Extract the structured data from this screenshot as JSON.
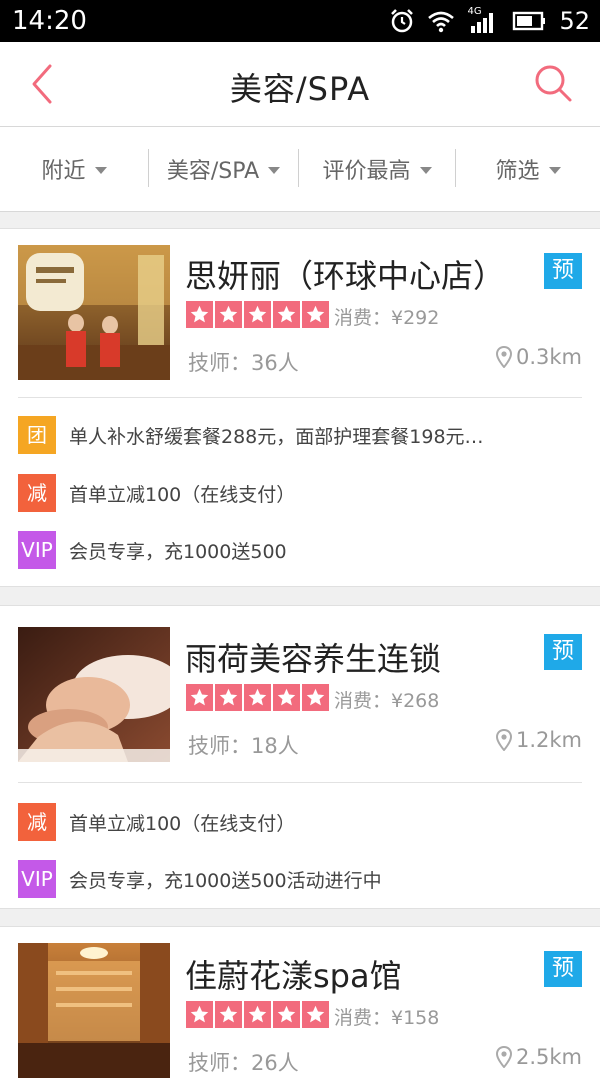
{
  "status_bar": {
    "time": "14:20",
    "network": "4G",
    "battery": "52"
  },
  "nav": {
    "title": "美容/SPA",
    "back_icon": "chevron-left-icon",
    "search_icon": "search-icon",
    "accent_color": "#f26b7d"
  },
  "filters": [
    {
      "label": "附近"
    },
    {
      "label": "美容/SPA"
    },
    {
      "label": "评价最高"
    },
    {
      "label": "筛选"
    }
  ],
  "colors": {
    "tuan": "#f5a623",
    "jian": "#f2623c",
    "vip": "#c459e8",
    "book": "#1fa9e8",
    "star": "#f26b7d"
  },
  "shops": [
    {
      "name": "思妍丽（环球中心店）",
      "book_label": "预",
      "rating": 5,
      "consume": "消费：¥292",
      "technicians": "技师：36人",
      "distance": "0.3km",
      "promos": [
        {
          "tag": "团",
          "type": "tuan",
          "text": "单人补水舒缓套餐288元，面部护理套餐198元…"
        },
        {
          "tag": "减",
          "type": "jian",
          "text": "首单立减100（在线支付）"
        },
        {
          "tag": "VIP",
          "type": "vip",
          "text": "会员专享，充1000送500"
        }
      ]
    },
    {
      "name": "雨荷美容养生连锁",
      "book_label": "预",
      "rating": 5,
      "consume": "消费：¥268",
      "technicians": "技师：18人",
      "distance": "1.2km",
      "promos": [
        {
          "tag": "减",
          "type": "jian",
          "text": "首单立减100（在线支付）"
        },
        {
          "tag": "VIP",
          "type": "vip",
          "text": "会员专享，充1000送500活动进行中"
        }
      ]
    },
    {
      "name": "佳蔚花漾spa馆",
      "book_label": "预",
      "rating": 5,
      "consume": "消费：¥158",
      "technicians": "技师：26人",
      "distance": "2.5km",
      "promos": []
    }
  ]
}
